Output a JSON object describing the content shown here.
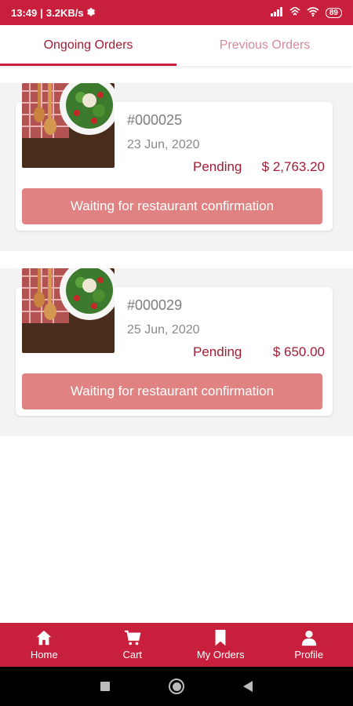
{
  "status_bar": {
    "time": "13:49",
    "network_speed": "3.2KB/s",
    "battery": "89"
  },
  "tabs": [
    {
      "label": "Ongoing Orders",
      "active": true
    },
    {
      "label": "Previous Orders",
      "active": false
    }
  ],
  "orders": [
    {
      "id": "#000025",
      "date": "23 Jun, 2020",
      "status": "Pending",
      "amount": "$ 2,763.20",
      "action_label": "Waiting for restaurant confirmation"
    },
    {
      "id": "#000029",
      "date": "25 Jun, 2020",
      "status": "Pending",
      "amount": "$ 650.00",
      "action_label": "Waiting for restaurant confirmation"
    }
  ],
  "bottom_nav": [
    {
      "label": "Home",
      "icon": "home-icon"
    },
    {
      "label": "Cart",
      "icon": "cart-icon"
    },
    {
      "label": "My Orders",
      "icon": "bookmark-icon"
    },
    {
      "label": "Profile",
      "icon": "person-icon"
    }
  ],
  "colors": {
    "brand": "#c8203c",
    "accent_text": "#a01c34",
    "button": "#e08282"
  }
}
